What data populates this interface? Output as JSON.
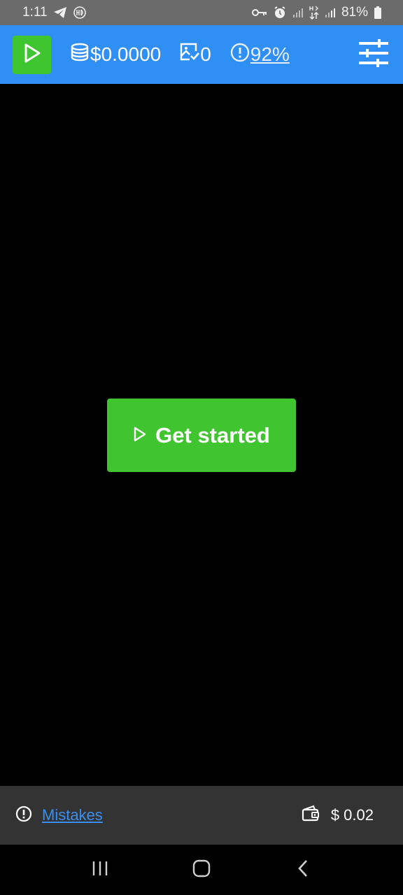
{
  "status_bar": {
    "time": "1:11",
    "battery_text": "81%",
    "icons": [
      "telegram-icon",
      "hd-icon",
      "vpn-key-icon",
      "alarm-icon",
      "signal-icon",
      "data-arrows-icon",
      "signal-icon",
      "battery-icon"
    ]
  },
  "header": {
    "balance": "$0.0000",
    "images_count": "0",
    "accuracy": "92%",
    "icons": [
      "play-icon",
      "coins-icon",
      "image-check-icon",
      "alert-circle-icon",
      "sliders-icon"
    ],
    "colors": {
      "bar": "#2f8ff5",
      "play": "#3fc52f"
    }
  },
  "main": {
    "cta_label": "Get started",
    "cta_color": "#40c42f"
  },
  "bottom_bar": {
    "mistakes_label": "Mistakes",
    "wallet_amount": "$ 0.02"
  },
  "nav_bar": {
    "icons": [
      "recent-apps-icon",
      "home-icon",
      "back-icon"
    ]
  }
}
